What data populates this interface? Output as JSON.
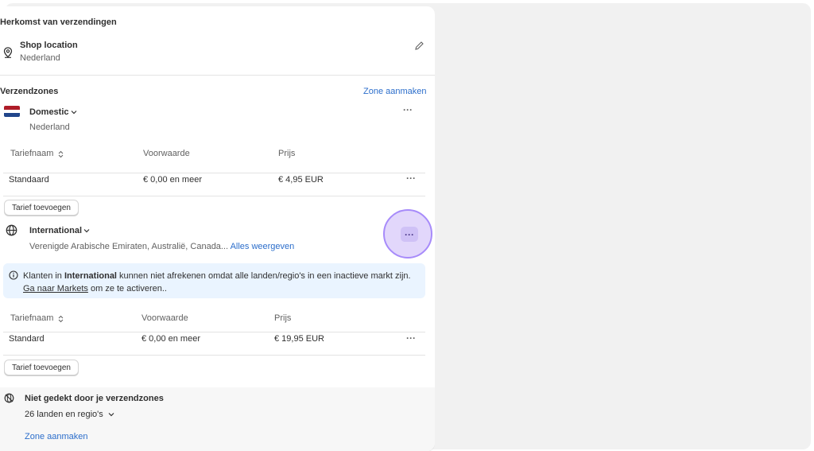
{
  "origin": {
    "heading": "Herkomst van verzendingen",
    "location_title": "Shop location",
    "location_country": "Nederland"
  },
  "zones": {
    "heading": "Verzendzones",
    "create_link": "Zone aanmaken",
    "domestic": {
      "name": "Domestic",
      "country": "Nederland",
      "columns": [
        "Tariefnaam",
        "Voorwaarde",
        "Prijs"
      ],
      "rows": [
        {
          "name": "Standaard",
          "condition": "€ 0,00 en meer",
          "price": "€ 4,95 EUR"
        }
      ],
      "add_rate": "Tarief toevoegen"
    },
    "international": {
      "name": "International",
      "countries": "Verenigde Arabische Emiraten, Australië, Canada...",
      "show_all": "Alles weergeven",
      "banner": {
        "prefix": "Klanten in ",
        "zone": "International",
        "suffix": " kunnen niet afrekenen omdat alle landen/regio's in een inactieve markt zijn.",
        "link": "Ga naar Markets",
        "link_suffix": " om ze te activeren.."
      },
      "columns": [
        "Tariefnaam",
        "Voorwaarde",
        "Prijs"
      ],
      "rows": [
        {
          "name": "Standard",
          "condition": "€ 0,00 en meer",
          "price": "€ 19,95 EUR"
        }
      ],
      "add_rate": "Tarief toevoegen"
    }
  },
  "uncovered": {
    "title": "Niet gedekt door je verzendzones",
    "count": "26 landen en regio's",
    "create_link": "Zone aanmaken"
  },
  "colors": {
    "link": "#2c6ecb",
    "banner_bg": "#eaf4ff",
    "highlight": "#a78bfa"
  },
  "icons": [
    "location-pin-icon",
    "pencil-icon",
    "netherlands-flag-icon",
    "chevron-down-icon",
    "globe-icon",
    "info-icon",
    "sort-icon",
    "globe-off-icon",
    "more-icon"
  ]
}
